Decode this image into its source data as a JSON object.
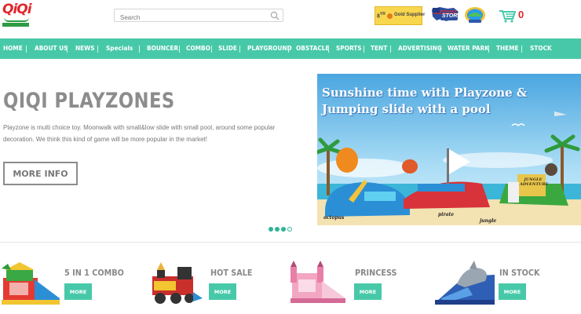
{
  "header": {
    "logo_text": "QiQi",
    "search": {
      "placeholder": "Search"
    },
    "gold_supplier": {
      "years": "8",
      "years_suffix": "YR",
      "label": "Gold Supplier"
    },
    "store_label": "STORE",
    "cart_count": "0"
  },
  "nav": {
    "items": [
      {
        "label": "HOME"
      },
      {
        "label": "ABOUT US"
      },
      {
        "label": "NEWS"
      },
      {
        "label": "Specials"
      },
      {
        "label": "BOUNCER"
      },
      {
        "label": "COMBO"
      },
      {
        "label": "SLIDE"
      },
      {
        "label": "PLAYGROUND"
      },
      {
        "label": "OBSTACLE"
      },
      {
        "label": "SPORTS"
      },
      {
        "label": "TENT"
      },
      {
        "label": "ADVERTISING"
      },
      {
        "label": "WATER PARK"
      },
      {
        "label": "THEME"
      },
      {
        "label": "STOCK"
      }
    ]
  },
  "hero": {
    "title": "QIQI PLAYZONES",
    "description": "Playzone is multi choice toy. Moonwalk with small&low slide with small pool, around some popular decoration. We think this kind of game will be more popular in the market!",
    "button": "MORE INFO",
    "banner_text": "Sunshine time with Playzone & Jumping slide with a pool",
    "banner_labels": [
      "octopus",
      "pirate",
      "jungle"
    ],
    "banner_sign": "JUNGLE ADVENTURE",
    "slides_total": 4,
    "slide_active": 4
  },
  "products": [
    {
      "title": "5 IN 1 COMBO",
      "button": "MORE"
    },
    {
      "title": "HOT SALE",
      "button": "MORE"
    },
    {
      "title": "PRINCESS",
      "button": "MORE"
    },
    {
      "title": "IN STOCK",
      "button": "MORE"
    }
  ],
  "colors": {
    "accent": "#47c9a9",
    "brand_red": "#e0262b",
    "title_gray": "#8c8c8c"
  }
}
